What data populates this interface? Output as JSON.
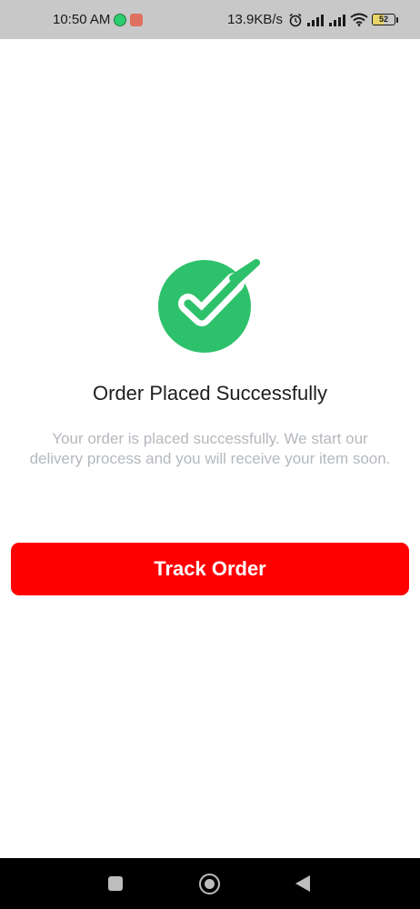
{
  "status_bar": {
    "time": "10:50 AM",
    "network_speed": "13.9KB/s",
    "battery_level": "52",
    "notification_icons": [
      "whatsapp-icon",
      "app-notification-icon"
    ],
    "system_icons": [
      "alarm-icon",
      "signal-icon",
      "signal-icon",
      "wifi-icon",
      "battery-icon"
    ]
  },
  "main": {
    "icon": "check-circle-icon",
    "icon_color": "#2ec16b",
    "title": "Order Placed Successfully",
    "message": "Your order is placed successfully. We start our delivery process and you will receive your item soon.",
    "track_button_label": "Track Order",
    "track_button_color": "#ff0000"
  },
  "nav_bar": {
    "items": [
      "recents-icon",
      "home-icon",
      "back-icon"
    ]
  }
}
